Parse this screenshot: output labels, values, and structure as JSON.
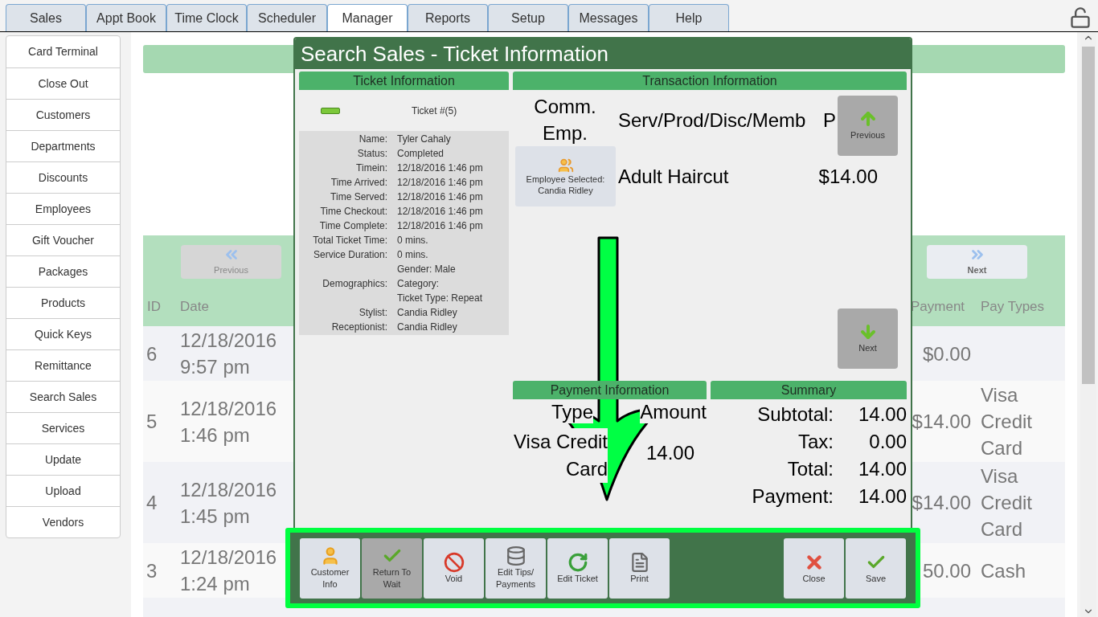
{
  "tabs": [
    {
      "label": "Sales",
      "selected": false
    },
    {
      "label": "Appt Book",
      "selected": false
    },
    {
      "label": "Time Clock",
      "selected": false
    },
    {
      "label": "Scheduler",
      "selected": false
    },
    {
      "label": "Manager",
      "selected": true
    },
    {
      "label": "Reports",
      "selected": false
    },
    {
      "label": "Setup",
      "selected": false
    },
    {
      "label": "Messages",
      "selected": false
    },
    {
      "label": "Help",
      "selected": false
    }
  ],
  "sidebar": {
    "items": [
      "Card Terminal",
      "Close Out",
      "Customers",
      "Departments",
      "Discounts",
      "Employees",
      "Gift Voucher",
      "Packages",
      "Products",
      "Quick Keys",
      "Remittance",
      "Search Sales",
      "Services",
      "Update",
      "Upload",
      "Vendors"
    ]
  },
  "sales_table": {
    "previous": "Previous",
    "next": "Next",
    "columns": {
      "id": "ID",
      "date": "Date",
      "payment": "Payment",
      "pay_types": "Pay Types"
    },
    "rows": [
      {
        "id": "6",
        "date": "12/18/2016 9:57 pm",
        "payment": "$0.00"
      },
      {
        "id": "5",
        "date": "12/18/2016 1:46 pm",
        "payment": "$14.00",
        "pay_types": "Visa Credit Card"
      },
      {
        "id": "4",
        "date": "12/18/2016 1:45 pm",
        "payment": "$14.00",
        "pay_types": "Visa Credit Card"
      },
      {
        "id": "3",
        "date": "12/18/2016 1:24 pm",
        "payment": "50.00",
        "pay_types": "Cash"
      }
    ]
  },
  "dialog": {
    "title": "Search Sales - Ticket Information",
    "ticket_info": {
      "header": "Ticket Information",
      "ticket_number": "Ticket #(5)",
      "fields": [
        {
          "label": "Name:",
          "value": [
            "Tyler Cahaly"
          ]
        },
        {
          "label": "Status:",
          "value": [
            "Completed"
          ]
        },
        {
          "label": "Timein:",
          "value": [
            "12/18/2016 1:46 pm"
          ]
        },
        {
          "label": "Time Arrived:",
          "value": [
            "12/18/2016 1:46 pm"
          ]
        },
        {
          "label": "Time Served:",
          "value": [
            "12/18/2016 1:46 pm"
          ]
        },
        {
          "label": "Time Checkout:",
          "value": [
            "12/18/2016 1:46 pm"
          ]
        },
        {
          "label": "Time Complete:",
          "value": [
            "12/18/2016 1:46 pm"
          ]
        },
        {
          "label": "Total Ticket Time:",
          "value": [
            "0 mins."
          ]
        },
        {
          "label": "Service Duration:",
          "value": [
            "0 mins."
          ]
        },
        {
          "label": "Demographics:",
          "value": [
            "Gender: Male",
            "Category:",
            "Ticket Type: Repeat"
          ]
        },
        {
          "label": "Stylist:",
          "value": [
            "Candia Ridley"
          ]
        },
        {
          "label": "Receptionist:",
          "value": [
            "Candia Ridley"
          ]
        }
      ]
    },
    "transaction": {
      "header": "Transaction Information",
      "columns": [
        "Comm. Emp.",
        "Serv/Prod/Disc/Memb",
        "P"
      ],
      "items": [
        {
          "employee": "Employee Selected: Candia Ridley",
          "name": "Adult Haircut",
          "price": "$14.00"
        }
      ],
      "previous": "Previous",
      "next": "Next"
    },
    "payment": {
      "header": "Payment Information",
      "columns": [
        "Type",
        "Amount"
      ],
      "rows": [
        {
          "type": "Visa Credit Card",
          "amount": "14.00"
        }
      ]
    },
    "summary": {
      "header": "Summary",
      "rows": [
        {
          "label": "Subtotal:",
          "value": "14.00"
        },
        {
          "label": "Tax:",
          "value": "0.00"
        },
        {
          "label": "Total:",
          "value": "14.00"
        },
        {
          "label": "Payment:",
          "value": "14.00"
        }
      ]
    },
    "toolbar": [
      {
        "label": "Customer Info",
        "kind": "customer",
        "selected": false
      },
      {
        "label": "Return To Wait",
        "kind": "return",
        "selected": true
      },
      {
        "label": "Void",
        "kind": "void",
        "selected": false
      },
      {
        "label": "Edit Tips/ Payments",
        "kind": "tips",
        "selected": false
      },
      {
        "label": "Edit Ticket",
        "kind": "edit",
        "selected": false
      },
      {
        "label": "Print",
        "kind": "print",
        "selected": false
      },
      {
        "label": "Close",
        "kind": "close",
        "selected": false
      },
      {
        "label": "Save",
        "kind": "save",
        "selected": false
      }
    ]
  }
}
